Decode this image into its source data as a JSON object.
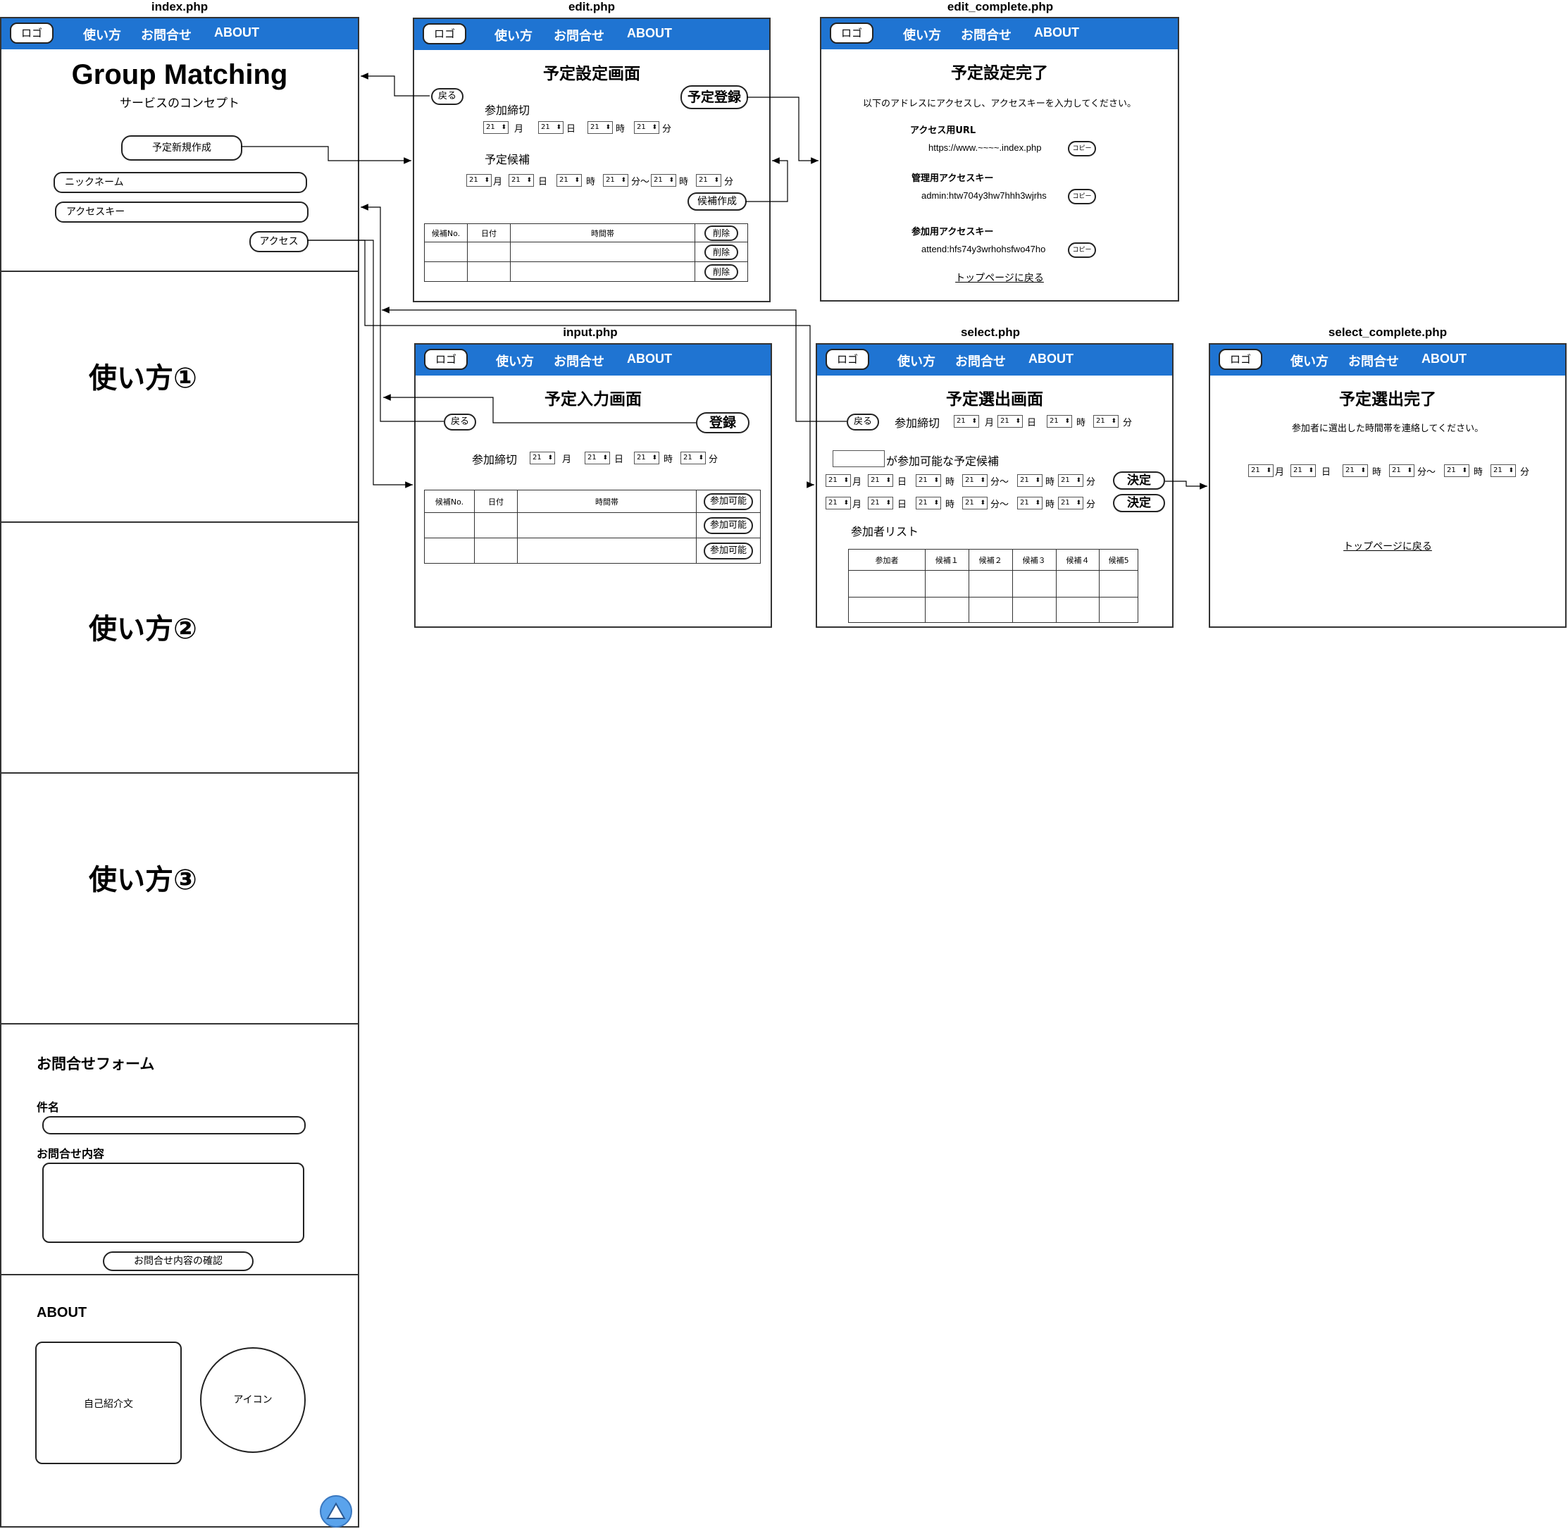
{
  "nav": {
    "logo": "ロゴ",
    "howto": "使い方",
    "contact": "お問合せ",
    "about": "ABOUT"
  },
  "time_value": "21",
  "units": {
    "month": "月",
    "day": "日",
    "hour": "時",
    "minute": "分",
    "minute_tilde": "分〜"
  },
  "colors": {
    "nav": "#1f74d2",
    "scroll_top": "#5aa3ec"
  },
  "index": {
    "file": "index.php",
    "title": "Group Matching",
    "concept": "サービスのコンセプト",
    "new_button": "予定新規作成",
    "nickname_placeholder": "ニックネーム",
    "accesskey_placeholder": "アクセスキー",
    "access_button": "アクセス",
    "howto1": "使い方①",
    "howto2": "使い方②",
    "howto3": "使い方③",
    "form_title": "お問合せフォーム",
    "subject_label": "件名",
    "content_label": "お問合せ内容",
    "confirm_button": "お問合せ内容の確認",
    "about_title": "ABOUT",
    "intro_box": "自己紹介文",
    "icon_circle": "アイコン",
    "scroll_top_icon": "triangle-up"
  },
  "edit": {
    "file": "edit.php",
    "heading": "予定設定画面",
    "back": "戻る",
    "register": "予定登録",
    "deadline_label": "参加締切",
    "candidate_label": "予定候補",
    "create_candidate": "候補作成",
    "table_headers": [
      "候補No.",
      "日付",
      "時間帯"
    ],
    "delete": "削除"
  },
  "edit_complete": {
    "file": "edit_complete.php",
    "heading": "予定設定完了",
    "instruction": "以下のアドレスにアクセスし、アクセスキーを入力してください。",
    "url_label": "アクセス用URL",
    "url_value": "https://www.~~~~.index.php",
    "admin_label": "管理用アクセスキー",
    "admin_value": "admin:htw704y3hw7hhh3wjrhs",
    "attend_label": "参加用アクセスキー",
    "attend_value": "attend:hfs74y3wrhohsfwo47ho",
    "copy": "コピー",
    "top_link": "トップページに戻る"
  },
  "input": {
    "file": "input.php",
    "heading": "予定入力画面",
    "back": "戻る",
    "register": "登録",
    "deadline_label": "参加締切",
    "table_headers": [
      "候補No.",
      "日付",
      "時間帯"
    ],
    "available": "参加可能"
  },
  "select": {
    "file": "select.php",
    "heading": "予定選出画面",
    "back": "戻る",
    "deadline_label": "参加締切",
    "available_label": "が参加可能な予定候補",
    "decide": "決定",
    "participants_label": "参加者リスト",
    "table_headers": [
      "参加者",
      "候補１",
      "候補２",
      "候補３",
      "候補４",
      "候補5"
    ]
  },
  "select_complete": {
    "file": "select_complete.php",
    "heading": "予定選出完了",
    "instruction": "参加者に選出した時間帯を連絡してください。",
    "top_link": "トップページに戻る"
  }
}
